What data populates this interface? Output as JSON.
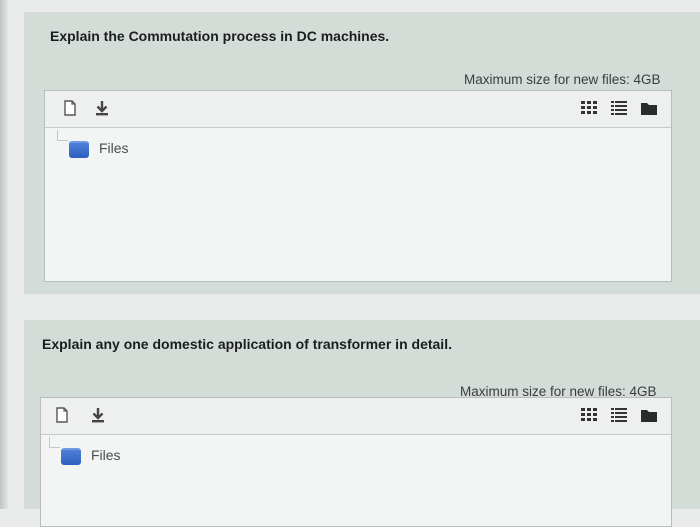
{
  "questions": [
    {
      "text": "Explain the Commutation process in DC machines.",
      "max_size": "Maximum size for new files: 4GB",
      "folder_label": "Files",
      "toolbar": {
        "add_file_icon": "add-file-icon",
        "download_icon": "download-icon",
        "view_icons": [
          "grid-view-icon",
          "list-view-icon",
          "folder-view-icon"
        ]
      }
    },
    {
      "text": "Explain any one domestic application of transformer in detail.",
      "max_size": "Maximum size for new files: 4GB",
      "folder_label": "Files",
      "toolbar": {
        "add_file_icon": "add-file-icon",
        "download_icon": "download-icon",
        "view_icons": [
          "grid-view-icon",
          "list-view-icon",
          "folder-view-icon"
        ]
      }
    }
  ],
  "colors": {
    "question_bg": "#d4dcd8",
    "folder_blue": "#2d5fc1",
    "text_dark": "#1c1d1f"
  }
}
